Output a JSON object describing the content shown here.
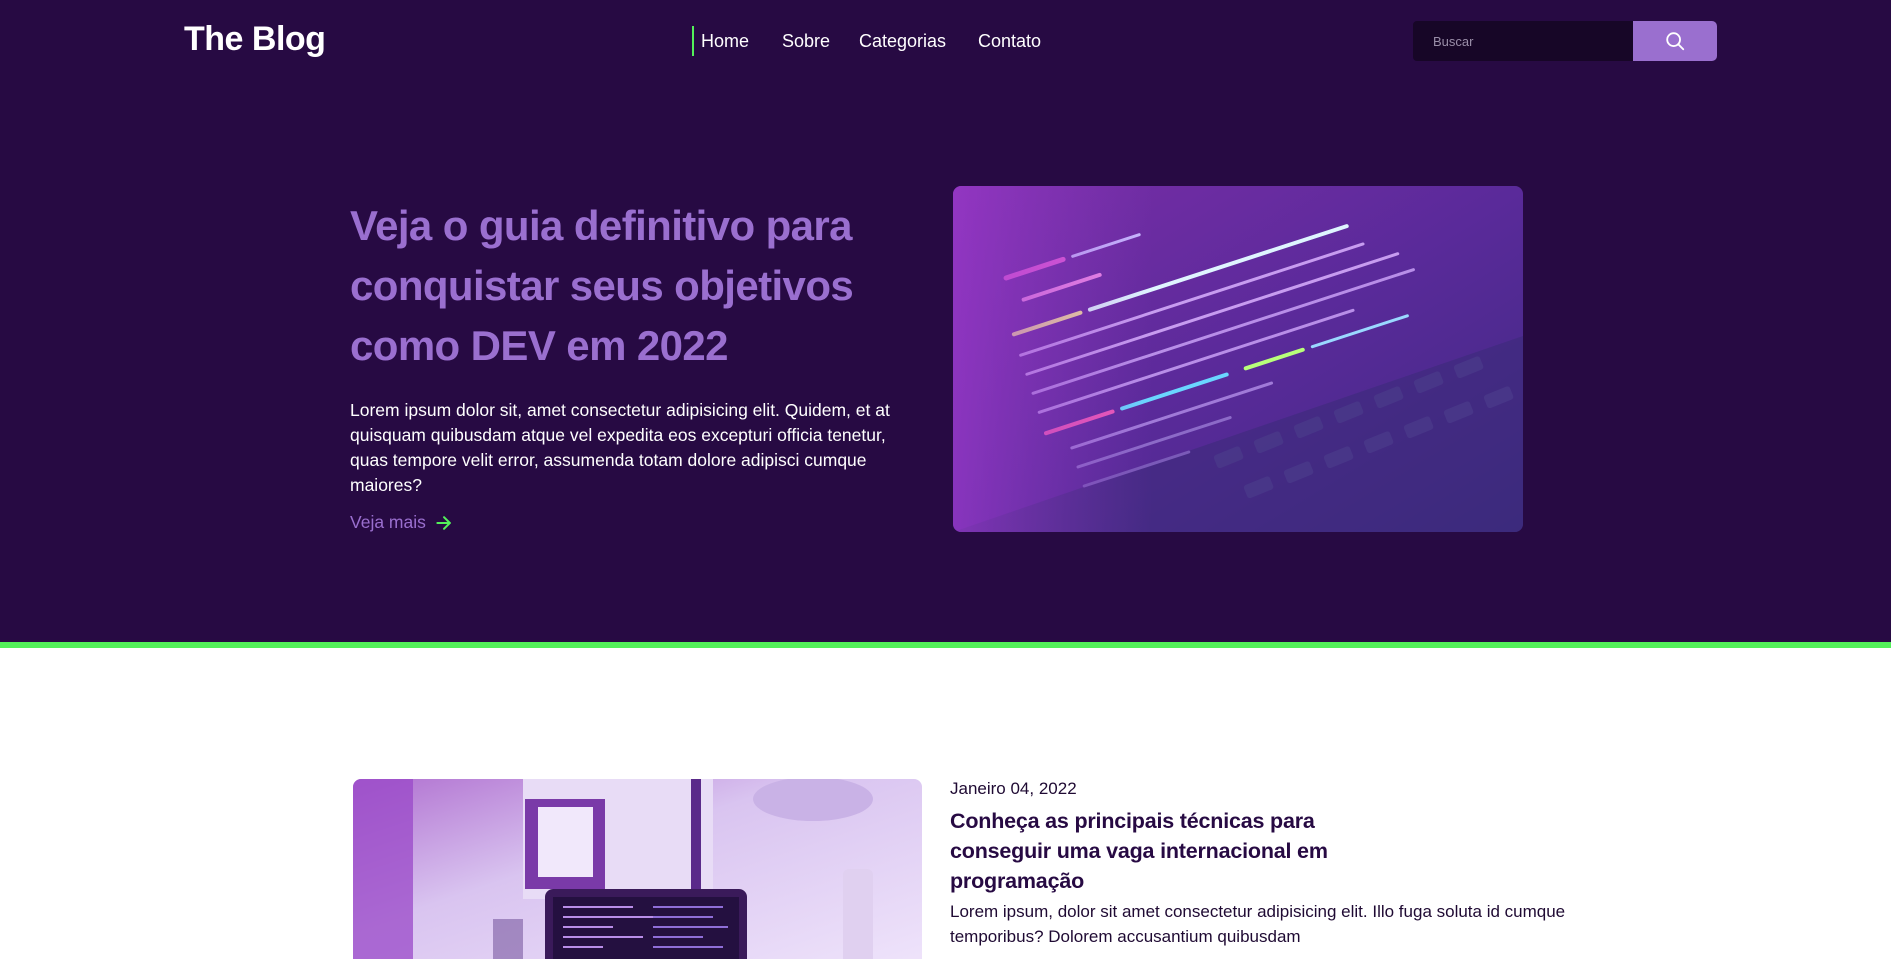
{
  "header": {
    "logo": "The Blog",
    "nav": [
      "Home",
      "Sobre",
      "Categorias",
      "Contato"
    ],
    "active_nav": "Home",
    "search": {
      "placeholder": "Buscar",
      "button_icon": "search-icon"
    }
  },
  "hero": {
    "title": "Veja o guia definitivo para conquistar seus objetivos como DEV em 2022",
    "description": "Lorem ipsum dolor sit, amet consectetur adipisicing elit. Quidem, et at quisquam quibusdam atque vel expedita eos excepturi officia tenetur, quas tempore velit error, assumenda totam dolore adipisci cumque maiores?",
    "link_label": "Veja mais",
    "link_icon": "arrow-right-icon",
    "image": "code-on-laptop-screen"
  },
  "post": {
    "date": "Janeiro 04, 2022",
    "title": "Conheça as principais técnicas para conseguir uma vaga internacional em programação",
    "excerpt": "Lorem ipsum, dolor sit amet consectetur adipisicing elit. Illo fuga soluta id cumque temporibus? Dolorem accusantium quibusdam",
    "image": "desk-with-laptop"
  },
  "colors": {
    "background_dark": "#270a43",
    "accent_purple": "#9a6fcf",
    "accent_green": "#53f05a",
    "search_input_bg": "#170627",
    "text_light": "#ffffff",
    "text_dark": "#270a43"
  }
}
